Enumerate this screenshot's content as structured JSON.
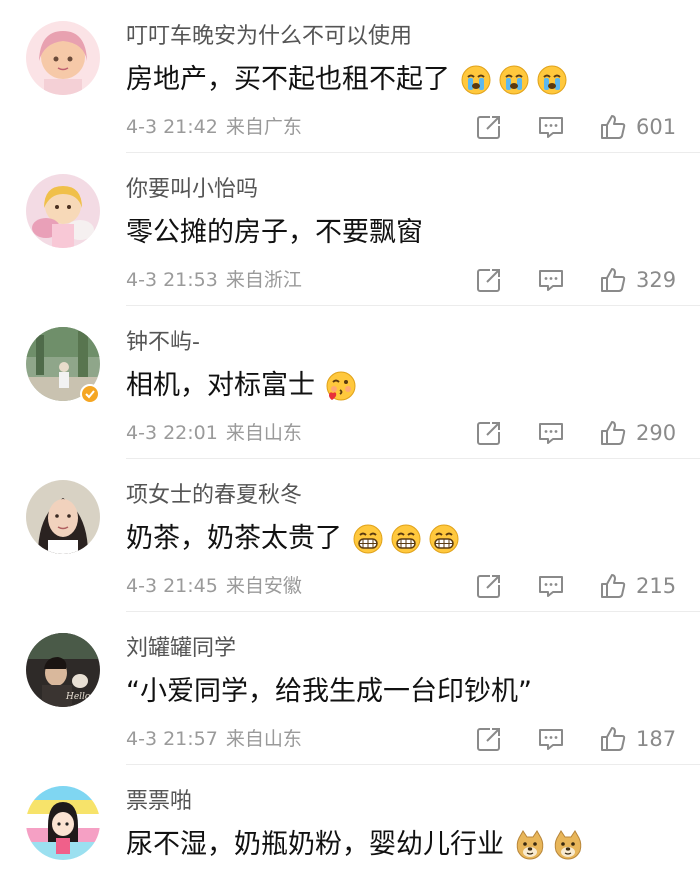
{
  "comments": [
    {
      "username": "叮叮车晚安为什么不可以使用",
      "content": "房地产，买不起也租不起了",
      "emojis": [
        "crying-emoji",
        "crying-emoji",
        "crying-emoji"
      ],
      "date": "4-3 21:42",
      "location": "来自广东",
      "likes": "601",
      "verified": false
    },
    {
      "username": "你要叫小怡吗",
      "content": "零公摊的房子，不要飘窗",
      "emojis": [],
      "date": "4-3 21:53",
      "location": "来自浙江",
      "likes": "329",
      "verified": false
    },
    {
      "username": "钟不屿-",
      "content": "相机，对标富士",
      "emojis": [
        "kiss-emoji"
      ],
      "date": "4-3 22:01",
      "location": "来自山东",
      "likes": "290",
      "verified": true
    },
    {
      "username": "项女士的春夏秋冬",
      "content": "奶茶，奶茶太贵了",
      "emojis": [
        "grin-emoji",
        "grin-emoji",
        "grin-emoji"
      ],
      "date": "4-3 21:45",
      "location": "来自安徽",
      "likes": "215",
      "verified": false
    },
    {
      "username": "刘罐罐同学",
      "content": "“小爱同学，给我生成一台印钞机”",
      "emojis": [],
      "date": "4-3 21:57",
      "location": "来自山东",
      "likes": "187",
      "verified": false
    },
    {
      "username": "票票啪",
      "content": "尿不湿，奶瓶奶粉，婴幼儿行业",
      "emojis": [
        "doge-emoji",
        "doge-emoji"
      ],
      "date": "",
      "location": "",
      "likes": "",
      "verified": false
    }
  ],
  "colors": {
    "text": "#111111",
    "username": "#555555",
    "meta": "#9a9a9a",
    "icon": "#8a8a8a",
    "verified_badge": "#f5a623"
  }
}
